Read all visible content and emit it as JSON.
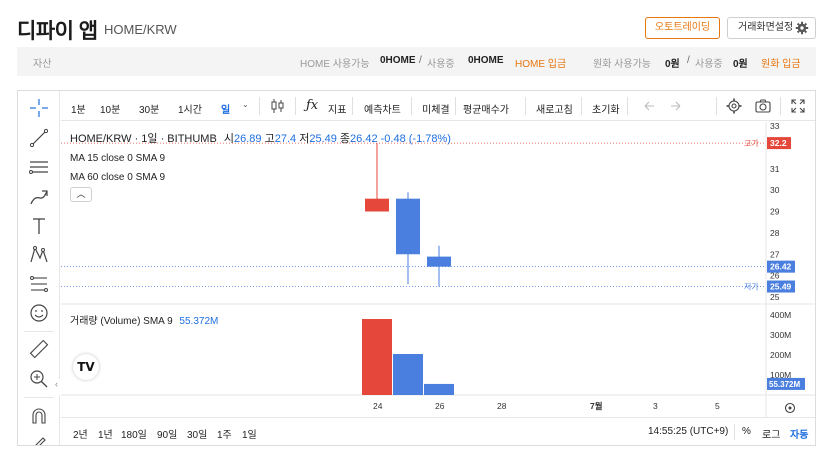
{
  "header": {
    "title": "디파이 앱",
    "subtitle": "HOME/KRW",
    "auto_trading_label": "오토트레이딩",
    "screen_settings_label": "거래화면설정"
  },
  "balance": {
    "asset_label": "자산",
    "home_available_label": "HOME 사용가능",
    "home_available_value": "0HOME",
    "sep1": "/",
    "in_use_label_1": "사용중",
    "home_in_use_value": "0HOME",
    "home_deposit_label": "HOME 입금",
    "krw_available_label": "원화 사용가능",
    "krw_available_value": "0원",
    "sep2": "/",
    "in_use_label_2": "사용중",
    "krw_in_use_value": "0원",
    "krw_deposit_label": "원화 입금"
  },
  "toolbar": {
    "intervals": [
      "1분",
      "10분",
      "30분",
      "1시간",
      "일"
    ],
    "active_interval": "일",
    "indicator_label": "지표",
    "predict_chart_label": "예측차트",
    "unfilled_label": "미체결",
    "avg_buy_label": "평균매수가",
    "refresh_label": "새로고침",
    "reset_label": "초기화"
  },
  "legend": {
    "symbol": "HOME/KRW · 1일 · BITHUMB",
    "open_label": "시",
    "open": "26.89",
    "high_label": "고",
    "high": "27.4",
    "low_label": "저",
    "low": "25.49",
    "close_label": "종",
    "close": "26.42",
    "change": "-0.48 (-1.78%)",
    "ma15": "MA 15 close 0 SMA 9",
    "ma60": "MA 60 close 0 SMA 9",
    "volume": "거래량 (Volume) SMA 9",
    "volume_value": "55.372M"
  },
  "price_axis": {
    "ticks": [
      "33",
      "31",
      "30",
      "29",
      "28",
      "27",
      "26",
      "25"
    ],
    "high_tag_label": "고가",
    "high_tag_value": "32.2",
    "current_value": "26.42",
    "low_tag_label": "저가",
    "low_tag_value": "25.49"
  },
  "volume_axis": {
    "ticks": [
      "400M",
      "300M",
      "200M",
      "100M"
    ],
    "current_value": "55.372M"
  },
  "time_axis": {
    "ticks": [
      "24",
      "26",
      "28",
      "7월",
      "3",
      "5"
    ]
  },
  "range_bar": {
    "ranges": [
      "2년",
      "1년",
      "180일",
      "90일",
      "30일",
      "1주",
      "1일"
    ],
    "time": "14:55:25 (UTC+9)",
    "percent_label": "%",
    "log_label": "로그",
    "auto_label": "자동"
  },
  "colors": {
    "accent_orange": "#e8760e",
    "up_red": "#e5483a",
    "down_blue": "#4a7fe0",
    "link_blue": "#1e6fe0"
  },
  "chart_data": {
    "type": "candlestick",
    "candles": [
      {
        "x": "24",
        "open": 29.0,
        "close": 29.6,
        "high": 32.2,
        "low": 29.0
      },
      {
        "x": "25",
        "open": 29.6,
        "close": 27.0,
        "high": 29.9,
        "low": 25.6
      },
      {
        "x": "26",
        "open": 26.89,
        "close": 26.42,
        "high": 27.4,
        "low": 25.49
      }
    ],
    "volume": [
      {
        "x": "24",
        "value": 380,
        "direction": "up"
      },
      {
        "x": "25",
        "value": 205,
        "direction": "down"
      },
      {
        "x": "26",
        "value": 55.372,
        "direction": "down"
      }
    ],
    "volume_unit": "M",
    "ylim": [
      25,
      33
    ],
    "volume_ylim": [
      0,
      400
    ],
    "grid": false
  }
}
